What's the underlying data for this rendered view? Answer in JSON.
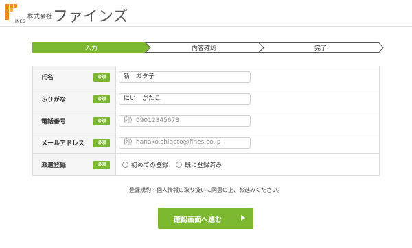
{
  "header": {
    "logo_text": "INES",
    "company_prefix": "株式会社",
    "company_name": "ファインズ",
    "brand_color": "#f08a1c"
  },
  "steps": [
    {
      "label": "入力",
      "active": true
    },
    {
      "label": "内容確認",
      "active": false
    },
    {
      "label": "完了",
      "active": false
    }
  ],
  "accent_color": "#7cb82f",
  "form": {
    "required_badge": "必須",
    "rows": [
      {
        "label": "氏名",
        "value": "新　ガタ子",
        "placeholder": ""
      },
      {
        "label": "ふりがな",
        "value": "にい　がたこ",
        "placeholder": ""
      },
      {
        "label": "電話番号",
        "value": "",
        "placeholder": "例）09012345678"
      },
      {
        "label": "メールアドレス",
        "value": "",
        "placeholder": "例）hanako.shigoto@fines.co.jp"
      },
      {
        "label": "派遣登録",
        "options": [
          "初めての登録",
          "既に登録済み"
        ]
      }
    ]
  },
  "agreement": {
    "link": "登録規約・個人情報の取り扱い",
    "rest": "に同意の上、お進みください。"
  },
  "submit_label": "確認画面へ進む"
}
